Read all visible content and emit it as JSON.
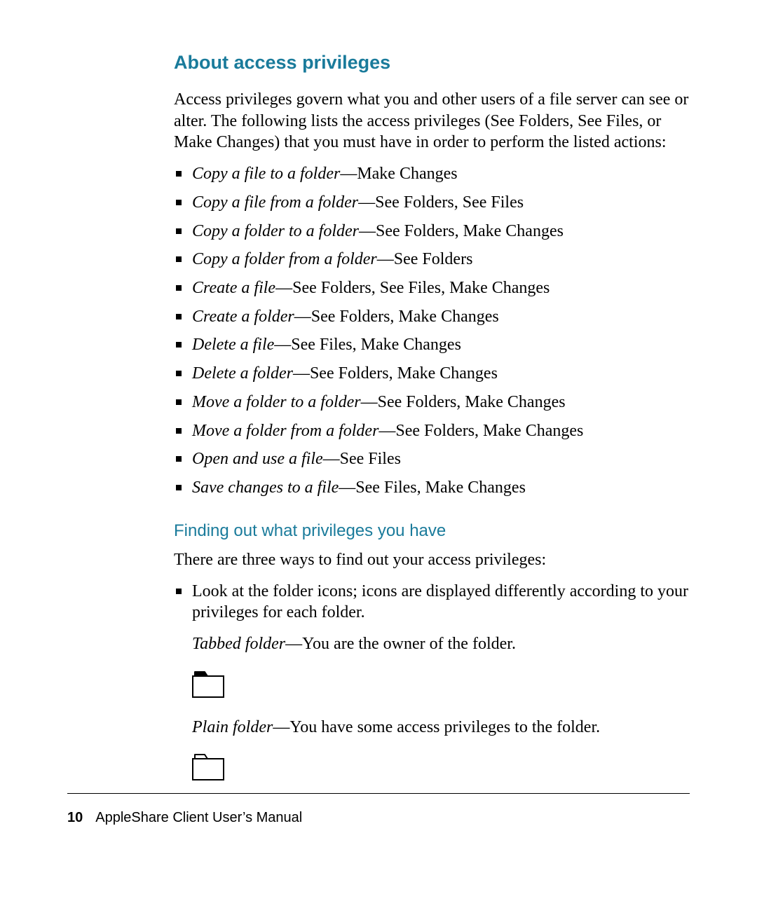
{
  "heading1": "About access privileges",
  "intro": "Access privileges govern what you and other users of a file server can see or alter. The following lists the access privileges (See Folders, See Files, or Make Changes) that you must have in order to perform the listed actions:",
  "privileges": [
    {
      "term": "Copy a file to a folder",
      "desc": "—Make Changes"
    },
    {
      "term": "Copy a file from a folder",
      "desc": "—See Folders, See Files"
    },
    {
      "term": "Copy a folder to a folder",
      "desc": "—See Folders, Make Changes"
    },
    {
      "term": "Copy a folder from a folder",
      "desc": "—See Folders"
    },
    {
      "term": "Create a file",
      "desc": "—See Folders, See Files, Make Changes"
    },
    {
      "term": "Create a folder",
      "desc": "—See Folders, Make Changes"
    },
    {
      "term": "Delete a file",
      "desc": "—See Files, Make Changes"
    },
    {
      "term": "Delete a folder",
      "desc": "—See Folders, Make Changes"
    },
    {
      "term": "Move a folder to a folder",
      "desc": "—See Folders, Make Changes"
    },
    {
      "term": "Move a folder from a folder",
      "desc": "—See Folders, Make Changes"
    },
    {
      "term": "Open and use a file",
      "desc": "—See Files"
    },
    {
      "term": "Save changes to a file",
      "desc": "—See Files, Make Changes"
    }
  ],
  "heading2": "Finding out what privileges you have",
  "sub_intro": "There are three ways to find out your access privileges:",
  "look_at_icons": "Look at the folder icons; icons are displayed differently according to your privileges for each folder.",
  "tabbed_term": "Tabbed folder",
  "tabbed_desc": "—You are the owner of the folder.",
  "plain_term": "Plain folder",
  "plain_desc": "—You have some access privileges to the folder.",
  "footer": {
    "page_number": "10",
    "manual_title": "AppleShare Client User’s Manual"
  }
}
